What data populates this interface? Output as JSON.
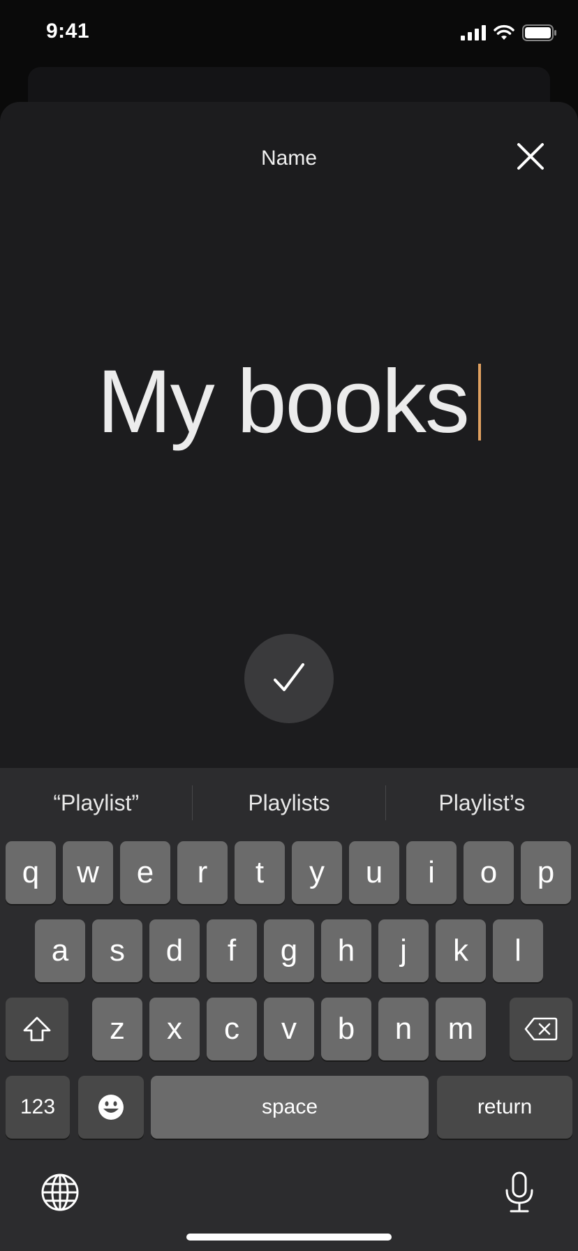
{
  "status_bar": {
    "time": "9:41"
  },
  "sheet": {
    "title": "Name",
    "name_value": "My books"
  },
  "keyboard": {
    "suggestions": [
      "“Playlist”",
      "Playlists",
      "Playlist’s"
    ],
    "row1": [
      "q",
      "w",
      "e",
      "r",
      "t",
      "y",
      "u",
      "i",
      "o",
      "p"
    ],
    "row2": [
      "a",
      "s",
      "d",
      "f",
      "g",
      "h",
      "j",
      "k",
      "l"
    ],
    "row3": [
      "z",
      "x",
      "c",
      "v",
      "b",
      "n",
      "m"
    ],
    "numbers_label": "123",
    "space_label": "space",
    "return_label": "return"
  },
  "colors": {
    "caret": "#e0a060",
    "sheet_bg": "#1c1c1e",
    "key_bg": "#6b6b6b",
    "keyboard_bg": "#2c2c2e"
  }
}
